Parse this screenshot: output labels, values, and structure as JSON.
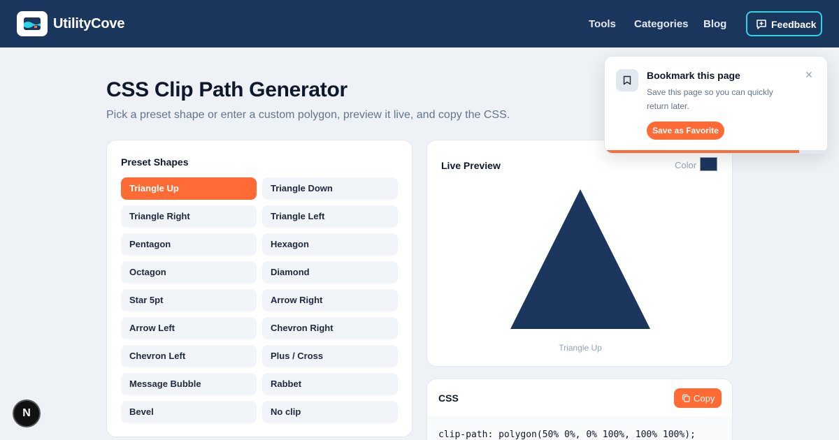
{
  "header": {
    "brand": "UtilityCove",
    "nav": [
      "Tools",
      "Categories",
      "Blog"
    ],
    "feedback_label": "Feedback"
  },
  "page": {
    "title": "CSS Clip Path Generator",
    "subtitle": "Pick a preset shape or enter a custom polygon, preview it live, and copy the CSS."
  },
  "presets": {
    "heading": "Preset Shapes",
    "items": [
      "Triangle Up",
      "Triangle Down",
      "Triangle Right",
      "Triangle Left",
      "Pentagon",
      "Hexagon",
      "Octagon",
      "Diamond",
      "Star 5pt",
      "Arrow Right",
      "Arrow Left",
      "Chevron Right",
      "Chevron Left",
      "Plus / Cross",
      "Message Bubble",
      "Rabbet",
      "Bevel",
      "No clip"
    ],
    "active": "Triangle Up"
  },
  "preview": {
    "heading": "Live Preview",
    "color_label": "Color",
    "color": "#1b365d",
    "caption": "Triangle Up"
  },
  "css": {
    "heading": "CSS",
    "copy_label": "Copy",
    "code": "clip-path: polygon(50% 0%, 0% 100%, 100% 100%);"
  },
  "bookmark": {
    "title": "Bookmark this page",
    "text": "Save this page so you can quickly return later.",
    "button": "Save as Favorite",
    "close": "×",
    "progress": 0.87
  },
  "badge": "N",
  "colors": {
    "header_bg": "#1b365d",
    "accent": "#ff6b35",
    "feedback_border": "#2dd4e8",
    "page_bg": "#eef2f6"
  },
  "icons": {
    "logo": "folder-wave-logo-icon",
    "feedback": "message-plus-icon",
    "bookmark": "bookmark-icon",
    "copy": "copy-icon",
    "close": "close-icon"
  }
}
